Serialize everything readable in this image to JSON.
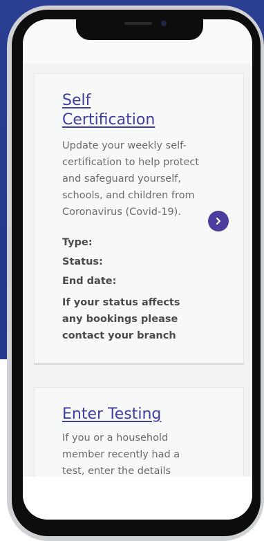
{
  "colors": {
    "background_blue": "#2a3f92",
    "link_purple": "#3f3fa0",
    "button_purple": "#4b3d9e",
    "body_text": "#6b6b6b",
    "label_text": "#4a4a4a"
  },
  "cards": [
    {
      "title_line1": "Self",
      "title_line2": "Certification",
      "description": "Update your weekly self-certification to help protect and safeguard yourself, schools, and children from Coronavirus (Covid-19).",
      "type_label": "Type:",
      "status_label": "Status:",
      "end_date_label": "End date:",
      "note": "If your status affects any bookings please contact your branch",
      "action_icon": "chevron-right-icon"
    },
    {
      "title": "Enter Testing",
      "description": "If you or a household member recently had a test, enter the details"
    }
  ]
}
